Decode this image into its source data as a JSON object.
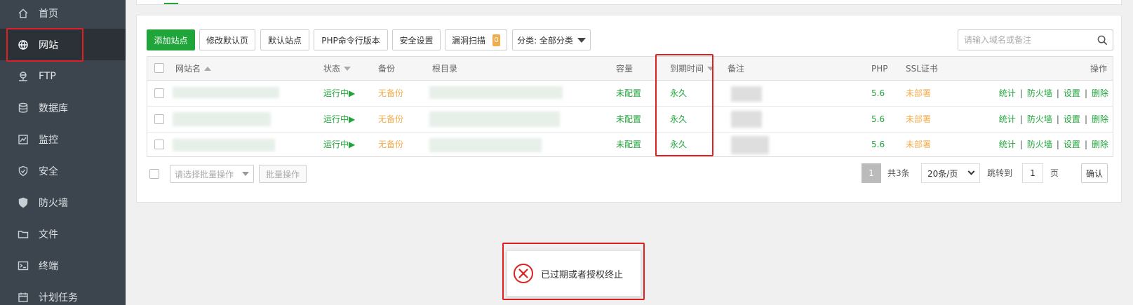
{
  "sidebar": {
    "items": [
      {
        "label": "首页",
        "icon": "home-icon"
      },
      {
        "label": "网站",
        "icon": "globe-icon",
        "active": true
      },
      {
        "label": "FTP",
        "icon": "ftp-icon"
      },
      {
        "label": "数据库",
        "icon": "database-icon"
      },
      {
        "label": "监控",
        "icon": "monitor-icon"
      },
      {
        "label": "安全",
        "icon": "shield-icon"
      },
      {
        "label": "防火墙",
        "icon": "firewall-icon"
      },
      {
        "label": "文件",
        "icon": "folder-icon"
      },
      {
        "label": "终端",
        "icon": "terminal-icon"
      },
      {
        "label": "计划任务",
        "icon": "calendar-icon"
      }
    ]
  },
  "toolbar": {
    "add_site": "添加站点",
    "edit_default_page": "修改默认页",
    "default_site": "默认站点",
    "php_cli_version": "PHP命令行版本",
    "security_settings": "安全设置",
    "vuln_scan": "漏洞扫描",
    "vuln_count": "0",
    "category": "分类: 全部分类",
    "search_placeholder": "请输入域名或备注"
  },
  "table": {
    "headers": {
      "site_name": "网站名",
      "status": "状态",
      "backup": "备份",
      "root": "根目录",
      "capacity": "容量",
      "expire": "到期时间",
      "remark": "备注",
      "php": "PHP",
      "ssl": "SSL证书",
      "actions": "操作"
    },
    "rows": [
      {
        "status": "运行中▶",
        "backup": "无备份",
        "capacity": "未配置",
        "expire": "永久",
        "php": "5.6",
        "ssl": "未部署"
      },
      {
        "status": "运行中▶",
        "backup": "无备份",
        "capacity": "未配置",
        "expire": "永久",
        "php": "5.6",
        "ssl": "未部署"
      },
      {
        "status": "运行中▶",
        "backup": "无备份",
        "capacity": "未配置",
        "expire": "永久",
        "php": "5.6",
        "ssl": "未部署"
      }
    ],
    "row_actions": {
      "stats": "统计",
      "firewall": "防火墙",
      "settings": "设置",
      "delete": "删除",
      "separator": "|"
    }
  },
  "footer": {
    "batch_placeholder": "请选择批量操作",
    "batch_button": "批量操作",
    "current_page": "1",
    "total": "共3条",
    "per_page": "20条/页",
    "jump_to": "跳转到",
    "jump_value": "1",
    "page_unit": "页",
    "confirm": "确认"
  },
  "toast": {
    "message": "已过期或者授权终止",
    "icon": "error-circle-icon"
  },
  "colors": {
    "accent": "#20a53a",
    "warning": "#f0ad4e",
    "highlight": "#e02020",
    "sidebar_bg": "#3c444d"
  }
}
